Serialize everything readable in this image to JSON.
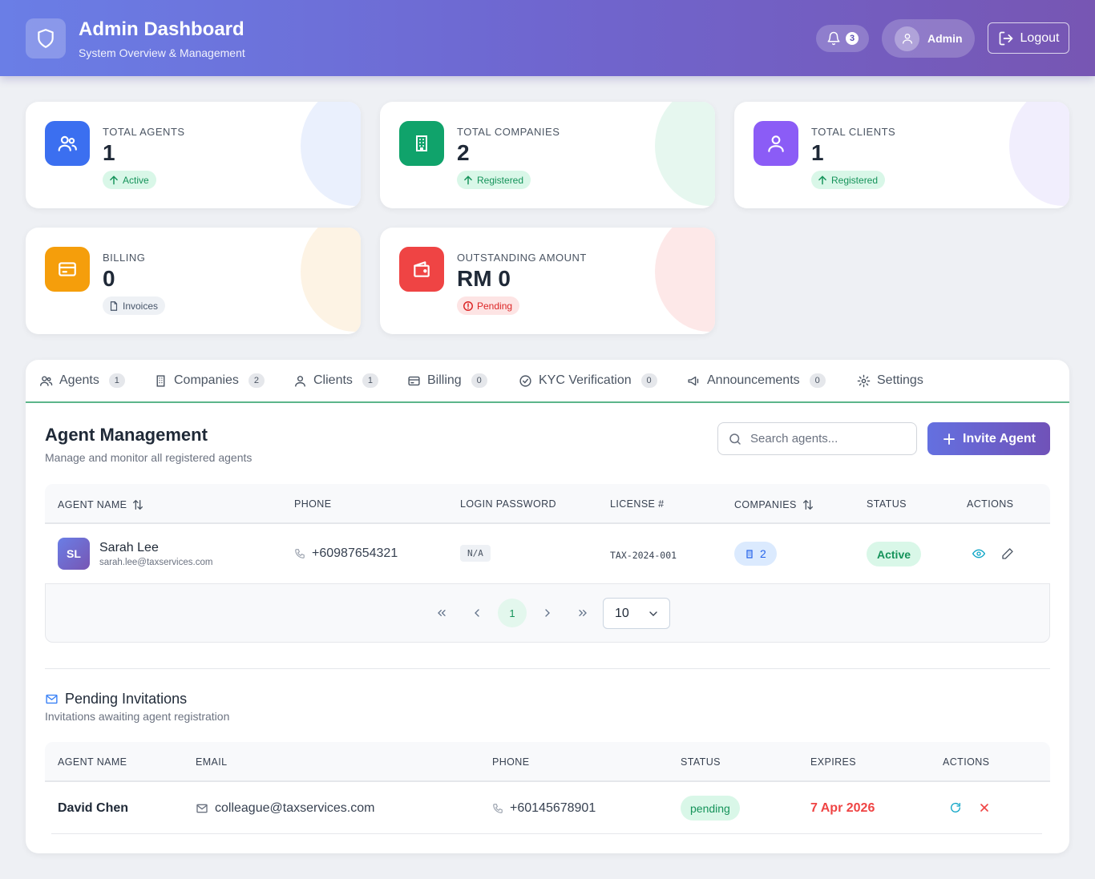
{
  "header": {
    "title": "Admin Dashboard",
    "subtitle": "System Overview & Management",
    "notification_count": "3",
    "user_name": "Admin",
    "logout_label": "Logout"
  },
  "stats": [
    {
      "label": "TOTAL AGENTS",
      "value": "1",
      "badge": "Active",
      "icon": "users-icon",
      "color": "#3b6ff0"
    },
    {
      "label": "TOTAL COMPANIES",
      "value": "2",
      "badge": "Registered",
      "icon": "building-icon",
      "color": "#10a36b"
    },
    {
      "label": "TOTAL CLIENTS",
      "value": "1",
      "badge": "Registered",
      "icon": "user-icon",
      "color": "#8b5cf6"
    },
    {
      "label": "BILLING",
      "value": "0",
      "badge": "Invoices",
      "icon": "credit-card-icon",
      "color": "#f59e0b"
    },
    {
      "label": "OUTSTANDING AMOUNT",
      "value": "RM 0",
      "badge": "Pending",
      "icon": "wallet-icon",
      "color": "#ef4444"
    }
  ],
  "tabs": [
    {
      "label": "Agents",
      "count": "1"
    },
    {
      "label": "Companies",
      "count": "2"
    },
    {
      "label": "Clients",
      "count": "1"
    },
    {
      "label": "Billing",
      "count": "0"
    },
    {
      "label": "KYC Verification",
      "count": "0"
    },
    {
      "label": "Announcements",
      "count": "0"
    },
    {
      "label": "Settings"
    }
  ],
  "agents": {
    "title": "Agent Management",
    "subtitle": "Manage and monitor all registered agents",
    "search_placeholder": "Search agents...",
    "invite_label": "Invite Agent",
    "columns": [
      "AGENT NAME",
      "PHONE",
      "LOGIN PASSWORD",
      "LICENSE #",
      "COMPANIES",
      "STATUS",
      "ACTIONS"
    ],
    "rows": [
      {
        "initials": "SL",
        "name": "Sarah Lee",
        "email": "sarah.lee@taxservices.com",
        "phone": "+60987654321",
        "password": "N/A",
        "license": "TAX-2024-001",
        "companies": "2",
        "status": "Active"
      }
    ],
    "pagination": {
      "current_page": "1",
      "page_size": "10"
    }
  },
  "invitations": {
    "title": "Pending Invitations",
    "subtitle": "Invitations awaiting agent registration",
    "columns": [
      "AGENT NAME",
      "EMAIL",
      "PHONE",
      "STATUS",
      "EXPIRES",
      "ACTIONS"
    ],
    "rows": [
      {
        "name": "David Chen",
        "email": "colleague@taxservices.com",
        "phone": "+60145678901",
        "status": "pending",
        "expires": "7 Apr 2026"
      }
    ]
  }
}
